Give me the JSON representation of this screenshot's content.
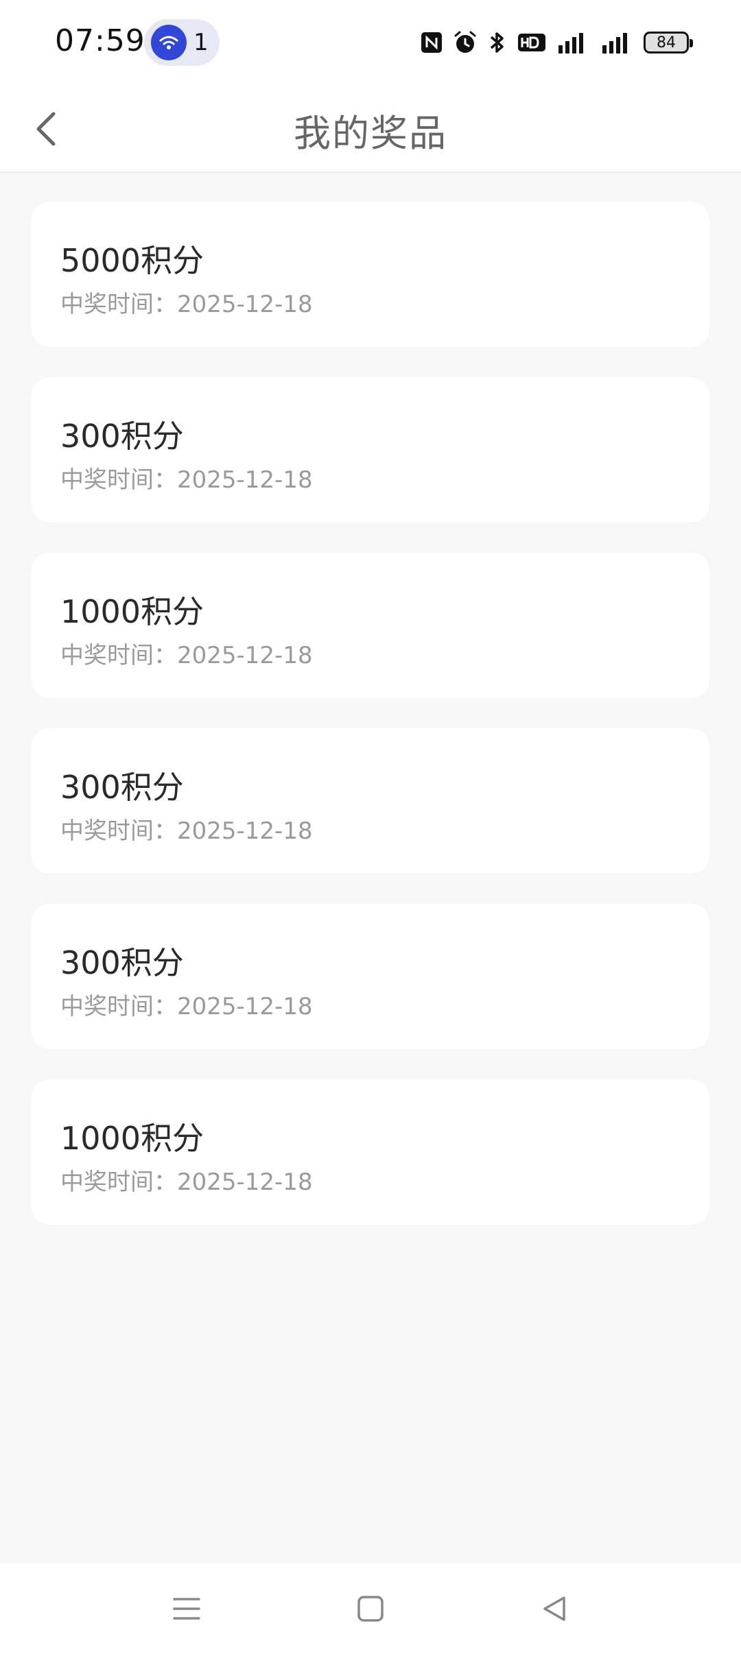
{
  "status_bar": {
    "time": "07:59",
    "hotspot_count": "1",
    "battery": "84",
    "icons": [
      "nfc-icon",
      "alarm-icon",
      "bluetooth-icon",
      "hd-icon",
      "signal-5g-icon",
      "signal-5g-icon"
    ]
  },
  "header": {
    "title": "我的奖品"
  },
  "prizes": [
    {
      "name": "5000积分",
      "time": "中奖时间：2025-12-18"
    },
    {
      "name": "300积分",
      "time": "中奖时间：2025-12-18"
    },
    {
      "name": "1000积分",
      "time": "中奖时间：2025-12-18"
    },
    {
      "name": "300积分",
      "time": "中奖时间：2025-12-18"
    },
    {
      "name": "300积分",
      "time": "中奖时间：2025-12-18"
    },
    {
      "name": "1000积分",
      "time": "中奖时间：2025-12-18"
    }
  ],
  "colors": {
    "background": "#f7f7f7",
    "card": "#ffffff",
    "title": "#666666",
    "prize_text": "#2a2a2a",
    "time_text": "#9a9a9a",
    "hotspot_blue": "#3347d6"
  }
}
